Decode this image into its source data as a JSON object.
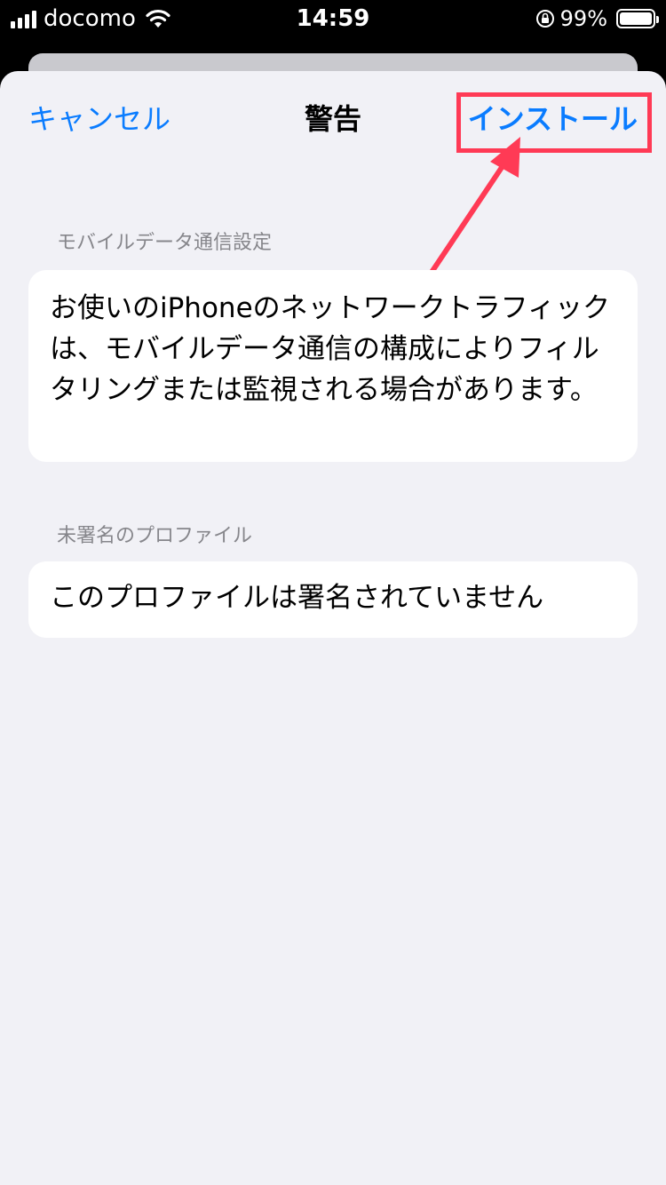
{
  "status_bar": {
    "carrier": "docomo",
    "time": "14:59",
    "battery_percent": "99%"
  },
  "nav": {
    "cancel_label": "キャンセル",
    "title": "警告",
    "install_label": "インストール"
  },
  "sections": [
    {
      "header": "モバイルデータ通信設定",
      "body": "お使いのiPhoneのネットワークトラフィックは、モバイルデータ通信の構成によりフィルタリングまたは監視される場合があります。"
    },
    {
      "header": "未署名のプロファイル",
      "body": "このプロファイルは署名されていません"
    }
  ],
  "colors": {
    "accent": "#0a7cff",
    "highlight": "#ff3a55",
    "background": "#f1f1f6"
  }
}
